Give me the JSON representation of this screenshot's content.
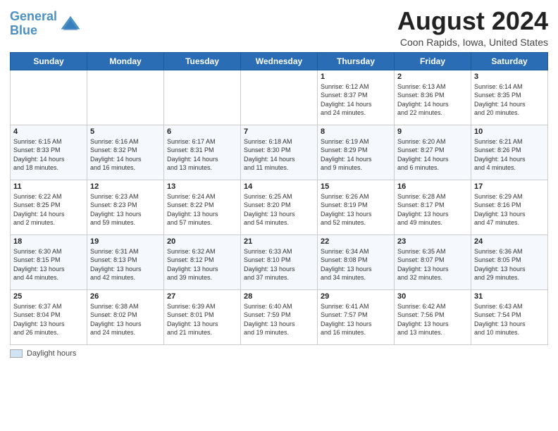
{
  "header": {
    "logo_line1": "General",
    "logo_line2": "Blue",
    "month_year": "August 2024",
    "location": "Coon Rapids, Iowa, United States"
  },
  "weekdays": [
    "Sunday",
    "Monday",
    "Tuesday",
    "Wednesday",
    "Thursday",
    "Friday",
    "Saturday"
  ],
  "weeks": [
    [
      {
        "day": "",
        "info": ""
      },
      {
        "day": "",
        "info": ""
      },
      {
        "day": "",
        "info": ""
      },
      {
        "day": "",
        "info": ""
      },
      {
        "day": "1",
        "info": "Sunrise: 6:12 AM\nSunset: 8:37 PM\nDaylight: 14 hours\nand 24 minutes."
      },
      {
        "day": "2",
        "info": "Sunrise: 6:13 AM\nSunset: 8:36 PM\nDaylight: 14 hours\nand 22 minutes."
      },
      {
        "day": "3",
        "info": "Sunrise: 6:14 AM\nSunset: 8:35 PM\nDaylight: 14 hours\nand 20 minutes."
      }
    ],
    [
      {
        "day": "4",
        "info": "Sunrise: 6:15 AM\nSunset: 8:33 PM\nDaylight: 14 hours\nand 18 minutes."
      },
      {
        "day": "5",
        "info": "Sunrise: 6:16 AM\nSunset: 8:32 PM\nDaylight: 14 hours\nand 16 minutes."
      },
      {
        "day": "6",
        "info": "Sunrise: 6:17 AM\nSunset: 8:31 PM\nDaylight: 14 hours\nand 13 minutes."
      },
      {
        "day": "7",
        "info": "Sunrise: 6:18 AM\nSunset: 8:30 PM\nDaylight: 14 hours\nand 11 minutes."
      },
      {
        "day": "8",
        "info": "Sunrise: 6:19 AM\nSunset: 8:29 PM\nDaylight: 14 hours\nand 9 minutes."
      },
      {
        "day": "9",
        "info": "Sunrise: 6:20 AM\nSunset: 8:27 PM\nDaylight: 14 hours\nand 6 minutes."
      },
      {
        "day": "10",
        "info": "Sunrise: 6:21 AM\nSunset: 8:26 PM\nDaylight: 14 hours\nand 4 minutes."
      }
    ],
    [
      {
        "day": "11",
        "info": "Sunrise: 6:22 AM\nSunset: 8:25 PM\nDaylight: 14 hours\nand 2 minutes."
      },
      {
        "day": "12",
        "info": "Sunrise: 6:23 AM\nSunset: 8:23 PM\nDaylight: 13 hours\nand 59 minutes."
      },
      {
        "day": "13",
        "info": "Sunrise: 6:24 AM\nSunset: 8:22 PM\nDaylight: 13 hours\nand 57 minutes."
      },
      {
        "day": "14",
        "info": "Sunrise: 6:25 AM\nSunset: 8:20 PM\nDaylight: 13 hours\nand 54 minutes."
      },
      {
        "day": "15",
        "info": "Sunrise: 6:26 AM\nSunset: 8:19 PM\nDaylight: 13 hours\nand 52 minutes."
      },
      {
        "day": "16",
        "info": "Sunrise: 6:28 AM\nSunset: 8:17 PM\nDaylight: 13 hours\nand 49 minutes."
      },
      {
        "day": "17",
        "info": "Sunrise: 6:29 AM\nSunset: 8:16 PM\nDaylight: 13 hours\nand 47 minutes."
      }
    ],
    [
      {
        "day": "18",
        "info": "Sunrise: 6:30 AM\nSunset: 8:15 PM\nDaylight: 13 hours\nand 44 minutes."
      },
      {
        "day": "19",
        "info": "Sunrise: 6:31 AM\nSunset: 8:13 PM\nDaylight: 13 hours\nand 42 minutes."
      },
      {
        "day": "20",
        "info": "Sunrise: 6:32 AM\nSunset: 8:12 PM\nDaylight: 13 hours\nand 39 minutes."
      },
      {
        "day": "21",
        "info": "Sunrise: 6:33 AM\nSunset: 8:10 PM\nDaylight: 13 hours\nand 37 minutes."
      },
      {
        "day": "22",
        "info": "Sunrise: 6:34 AM\nSunset: 8:08 PM\nDaylight: 13 hours\nand 34 minutes."
      },
      {
        "day": "23",
        "info": "Sunrise: 6:35 AM\nSunset: 8:07 PM\nDaylight: 13 hours\nand 32 minutes."
      },
      {
        "day": "24",
        "info": "Sunrise: 6:36 AM\nSunset: 8:05 PM\nDaylight: 13 hours\nand 29 minutes."
      }
    ],
    [
      {
        "day": "25",
        "info": "Sunrise: 6:37 AM\nSunset: 8:04 PM\nDaylight: 13 hours\nand 26 minutes."
      },
      {
        "day": "26",
        "info": "Sunrise: 6:38 AM\nSunset: 8:02 PM\nDaylight: 13 hours\nand 24 minutes."
      },
      {
        "day": "27",
        "info": "Sunrise: 6:39 AM\nSunset: 8:01 PM\nDaylight: 13 hours\nand 21 minutes."
      },
      {
        "day": "28",
        "info": "Sunrise: 6:40 AM\nSunset: 7:59 PM\nDaylight: 13 hours\nand 19 minutes."
      },
      {
        "day": "29",
        "info": "Sunrise: 6:41 AM\nSunset: 7:57 PM\nDaylight: 13 hours\nand 16 minutes."
      },
      {
        "day": "30",
        "info": "Sunrise: 6:42 AM\nSunset: 7:56 PM\nDaylight: 13 hours\nand 13 minutes."
      },
      {
        "day": "31",
        "info": "Sunrise: 6:43 AM\nSunset: 7:54 PM\nDaylight: 13 hours\nand 10 minutes."
      }
    ]
  ],
  "legend": {
    "box_label": "Daylight hours"
  }
}
